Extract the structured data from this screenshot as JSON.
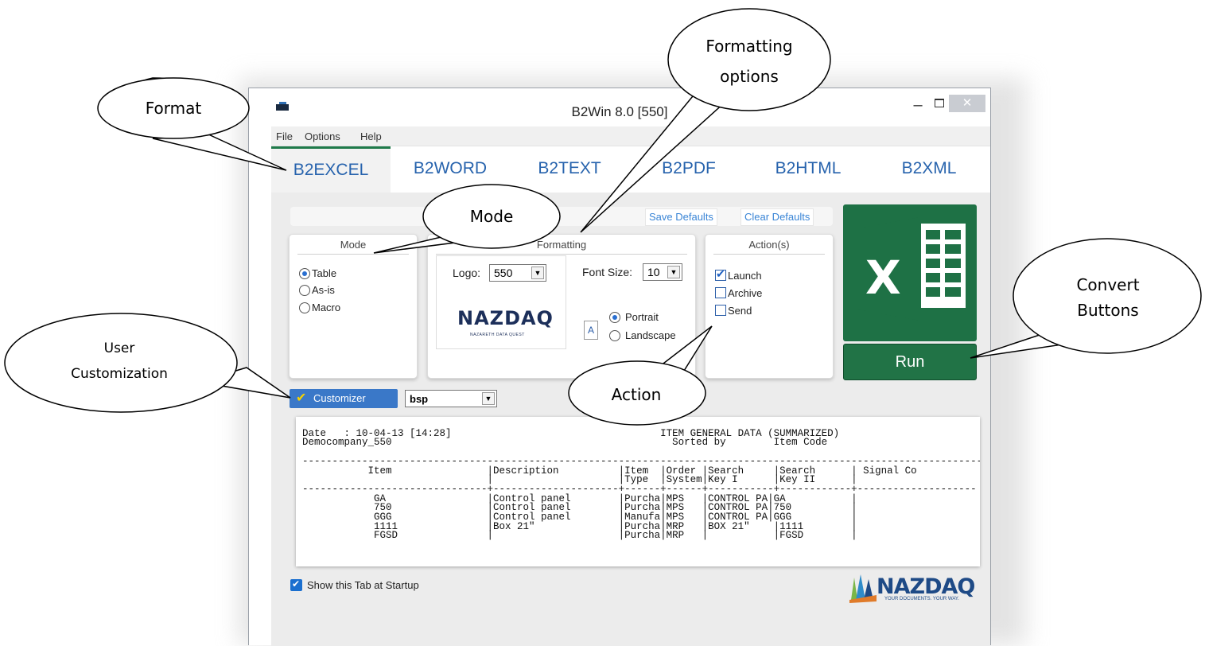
{
  "window": {
    "title": "B2Win 8.0 [550]"
  },
  "menu": [
    "File",
    "Options",
    "Help"
  ],
  "tabs": [
    "B2EXCEL",
    "B2WORD",
    "B2TEXT",
    "B2PDF",
    "B2HTML",
    "B2XML"
  ],
  "defaults": {
    "save": "Save Defaults",
    "clear": "Clear Defaults"
  },
  "mode": {
    "title": "Mode",
    "options": [
      "Table",
      "As-is",
      "Macro"
    ],
    "selected": "Table"
  },
  "formatting": {
    "title": "Formatting",
    "logo_label": "Logo:",
    "logo_value": "550",
    "font_size_label": "Font Size:",
    "font_size_value": "10",
    "logo_text": "NAZDAQ",
    "logo_subtext": "NAZARETH DATA QUEST",
    "orientation": [
      "Portrait",
      "Landscape"
    ],
    "orientation_selected": "Portrait",
    "page_icon_letter": "A"
  },
  "actions": {
    "title": "Action(s)",
    "items": [
      {
        "label": "Launch",
        "checked": true
      },
      {
        "label": "Archive",
        "checked": false
      },
      {
        "label": "Send",
        "checked": false
      }
    ]
  },
  "run": {
    "label": "Run"
  },
  "customizer": {
    "label": "Customizer",
    "profile": "bsp"
  },
  "preview": {
    "lines": [
      "",
      "Date   : 10-04-13 [14:28]                                   ITEM GENERAL DATA (SUMMARIZED)",
      "Democompany_550                                               Sorted by        Item Code",
      "",
      "---------------------------------------------------------------------------------------------------------------------",
      "           Item                |Description          |Item  |Order |Search     |Search      | Signal Co",
      "                               |                     |Type  |System|Key I      |Key II      |",
      "-------------------------------+---------------------+------+------+-----------+------------+--------------------",
      "            GA                 |Control panel        |Purcha|MPS   |CONTROL PA|GA           |",
      "            750                |Control panel        |Purcha|MPS   |CONTROL PA|750          |",
      "            GGG                |Control panel        |Manufa|MPS   |CONTROL PA|GGG          |",
      "            1111               |Box 21\"              |Purcha|MRP   |BOX 21\"    |1111        |",
      "            FGSD               |                     |Purcha|MRP   |           |FGSD        |"
    ]
  },
  "startup": {
    "label": "Show this Tab at Startup",
    "checked": true
  },
  "brand": {
    "name": "NAZDAQ",
    "tagline": "YOUR DOCUMENTS. YOUR WAY."
  },
  "callouts": {
    "format": "Format",
    "formatting_line1": "Formatting",
    "formatting_line2": "options",
    "mode": "Mode",
    "user_line1": "User",
    "user_line2": "Customization",
    "convert_line1": "Convert",
    "convert_line2": "Buttons",
    "action": "Action"
  },
  "colors": {
    "tab_text": "#2763ad",
    "excel_green": "#217346",
    "customizer_blue": "#3a78c8"
  }
}
